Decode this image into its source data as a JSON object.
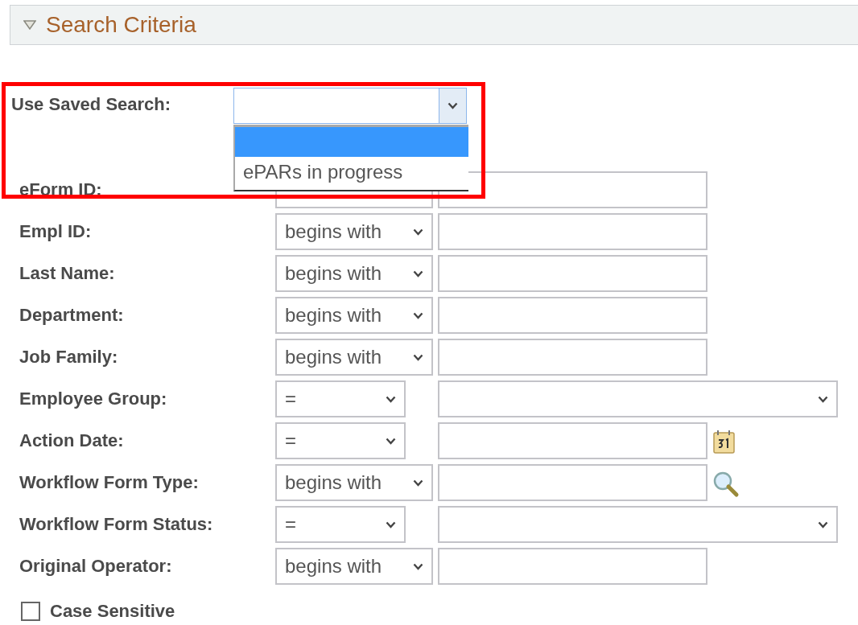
{
  "section": {
    "title": "Search Criteria",
    "expanded": true
  },
  "saved_search": {
    "label": "Use Saved Search:",
    "open": true,
    "options": [
      {
        "selected": true
      },
      {
        "label": "ePARs in progress",
        "selected": false
      }
    ]
  },
  "fields": [
    {
      "label": "eForm ID:",
      "kind": "text"
    },
    {
      "label": "Empl ID:",
      "operator": "begins with",
      "kind": "text"
    },
    {
      "label": "Last Name:",
      "operator": "begins with",
      "kind": "text"
    },
    {
      "label": "Department:",
      "operator": "begins with",
      "kind": "text"
    },
    {
      "label": "Job Family:",
      "operator": "begins with",
      "kind": "text"
    },
    {
      "label": "Employee Group:",
      "operator": "=",
      "kind": "dropdown"
    },
    {
      "label": "Action Date:",
      "operator": "=",
      "kind": "date"
    },
    {
      "label": "Workflow Form Type:",
      "operator": "begins with",
      "kind": "lookup"
    },
    {
      "label": "Workflow Form Status:",
      "operator": "=",
      "kind": "dropdown"
    },
    {
      "label": "Original Operator:",
      "operator": "begins with",
      "kind": "text"
    }
  ],
  "case_sensitive": {
    "label": "Case Sensitive",
    "checked": false
  },
  "highlight": {
    "kind": "frame"
  }
}
